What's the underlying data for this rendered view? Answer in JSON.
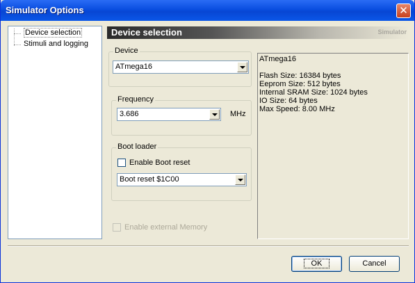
{
  "window": {
    "title": "Simulator Options",
    "close_glyph": "✕"
  },
  "tree": {
    "items": [
      {
        "label": "Device selection"
      },
      {
        "label": "Stimuli and logging"
      }
    ]
  },
  "header": {
    "title": "Device selection",
    "right_text": "Simulator"
  },
  "device": {
    "group_label": "Device",
    "value": "ATmega16"
  },
  "frequency": {
    "group_label": "Frequency",
    "value": "3.686",
    "unit": "MHz"
  },
  "bootloader": {
    "group_label": "Boot loader",
    "enable_label": "Enable Boot reset",
    "enable_checked": false,
    "reset_value": "Boot reset $1C00"
  },
  "external_memory": {
    "label": "Enable external Memory",
    "checked": false,
    "enabled": false
  },
  "info": {
    "device_name": "ATmega16",
    "flash": "Flash Size: 16384 bytes",
    "eeprom": "Eeprom Size: 512 bytes",
    "sram": "Internal SRAM Size: 1024 bytes",
    "io": "IO Size: 64 bytes",
    "speed": "Max Speed: 8.00 MHz"
  },
  "buttons": {
    "ok": "OK",
    "cancel": "Cancel"
  }
}
